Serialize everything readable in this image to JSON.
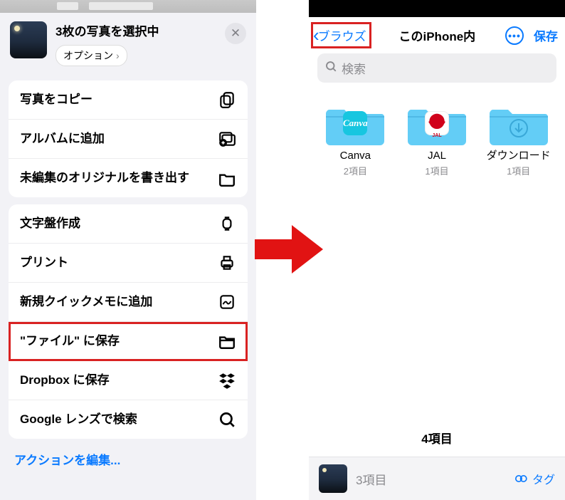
{
  "colors": {
    "accent": "#0a7aff",
    "highlight": "#d92222"
  },
  "left": {
    "title": "3枚の写真を選択中",
    "options_label": "オプション",
    "groups": [
      [
        {
          "label": "写真をコピー",
          "icon": "copy-icon"
        },
        {
          "label": "アルバムに追加",
          "icon": "add-album-icon"
        },
        {
          "label": "未編集のオリジナルを書き出す",
          "icon": "export-folder-icon"
        }
      ],
      [
        {
          "label": "文字盤作成",
          "icon": "watch-icon"
        },
        {
          "label": "プリント",
          "icon": "printer-icon"
        },
        {
          "label": "新規クイックメモに追加",
          "icon": "quicknote-icon"
        },
        {
          "label": "\"ファイル\" に保存",
          "icon": "folder-icon",
          "highlight": true
        },
        {
          "label": "Dropbox に保存",
          "icon": "dropbox-icon"
        },
        {
          "label": "Google レンズで検索",
          "icon": "search-icon"
        }
      ]
    ],
    "edit_actions_label": "アクションを編集..."
  },
  "right": {
    "back_label": "ブラウズ",
    "location_label": "このiPhone内",
    "save_label": "保存",
    "search_placeholder": "検索",
    "folders": [
      {
        "name": "Canva",
        "count": "2項目",
        "badge": "Canva",
        "badge_bg": "#17c6e0"
      },
      {
        "name": "JAL",
        "count": "1項目",
        "badge": "JAL",
        "badge_bg": "#ffffff"
      },
      {
        "name": "ダウンロード",
        "count": "1項目",
        "badge": "download",
        "badge_bg": ""
      }
    ],
    "total_label": "4項目",
    "bottom_count": "3項目",
    "tag_label": "タグ"
  }
}
